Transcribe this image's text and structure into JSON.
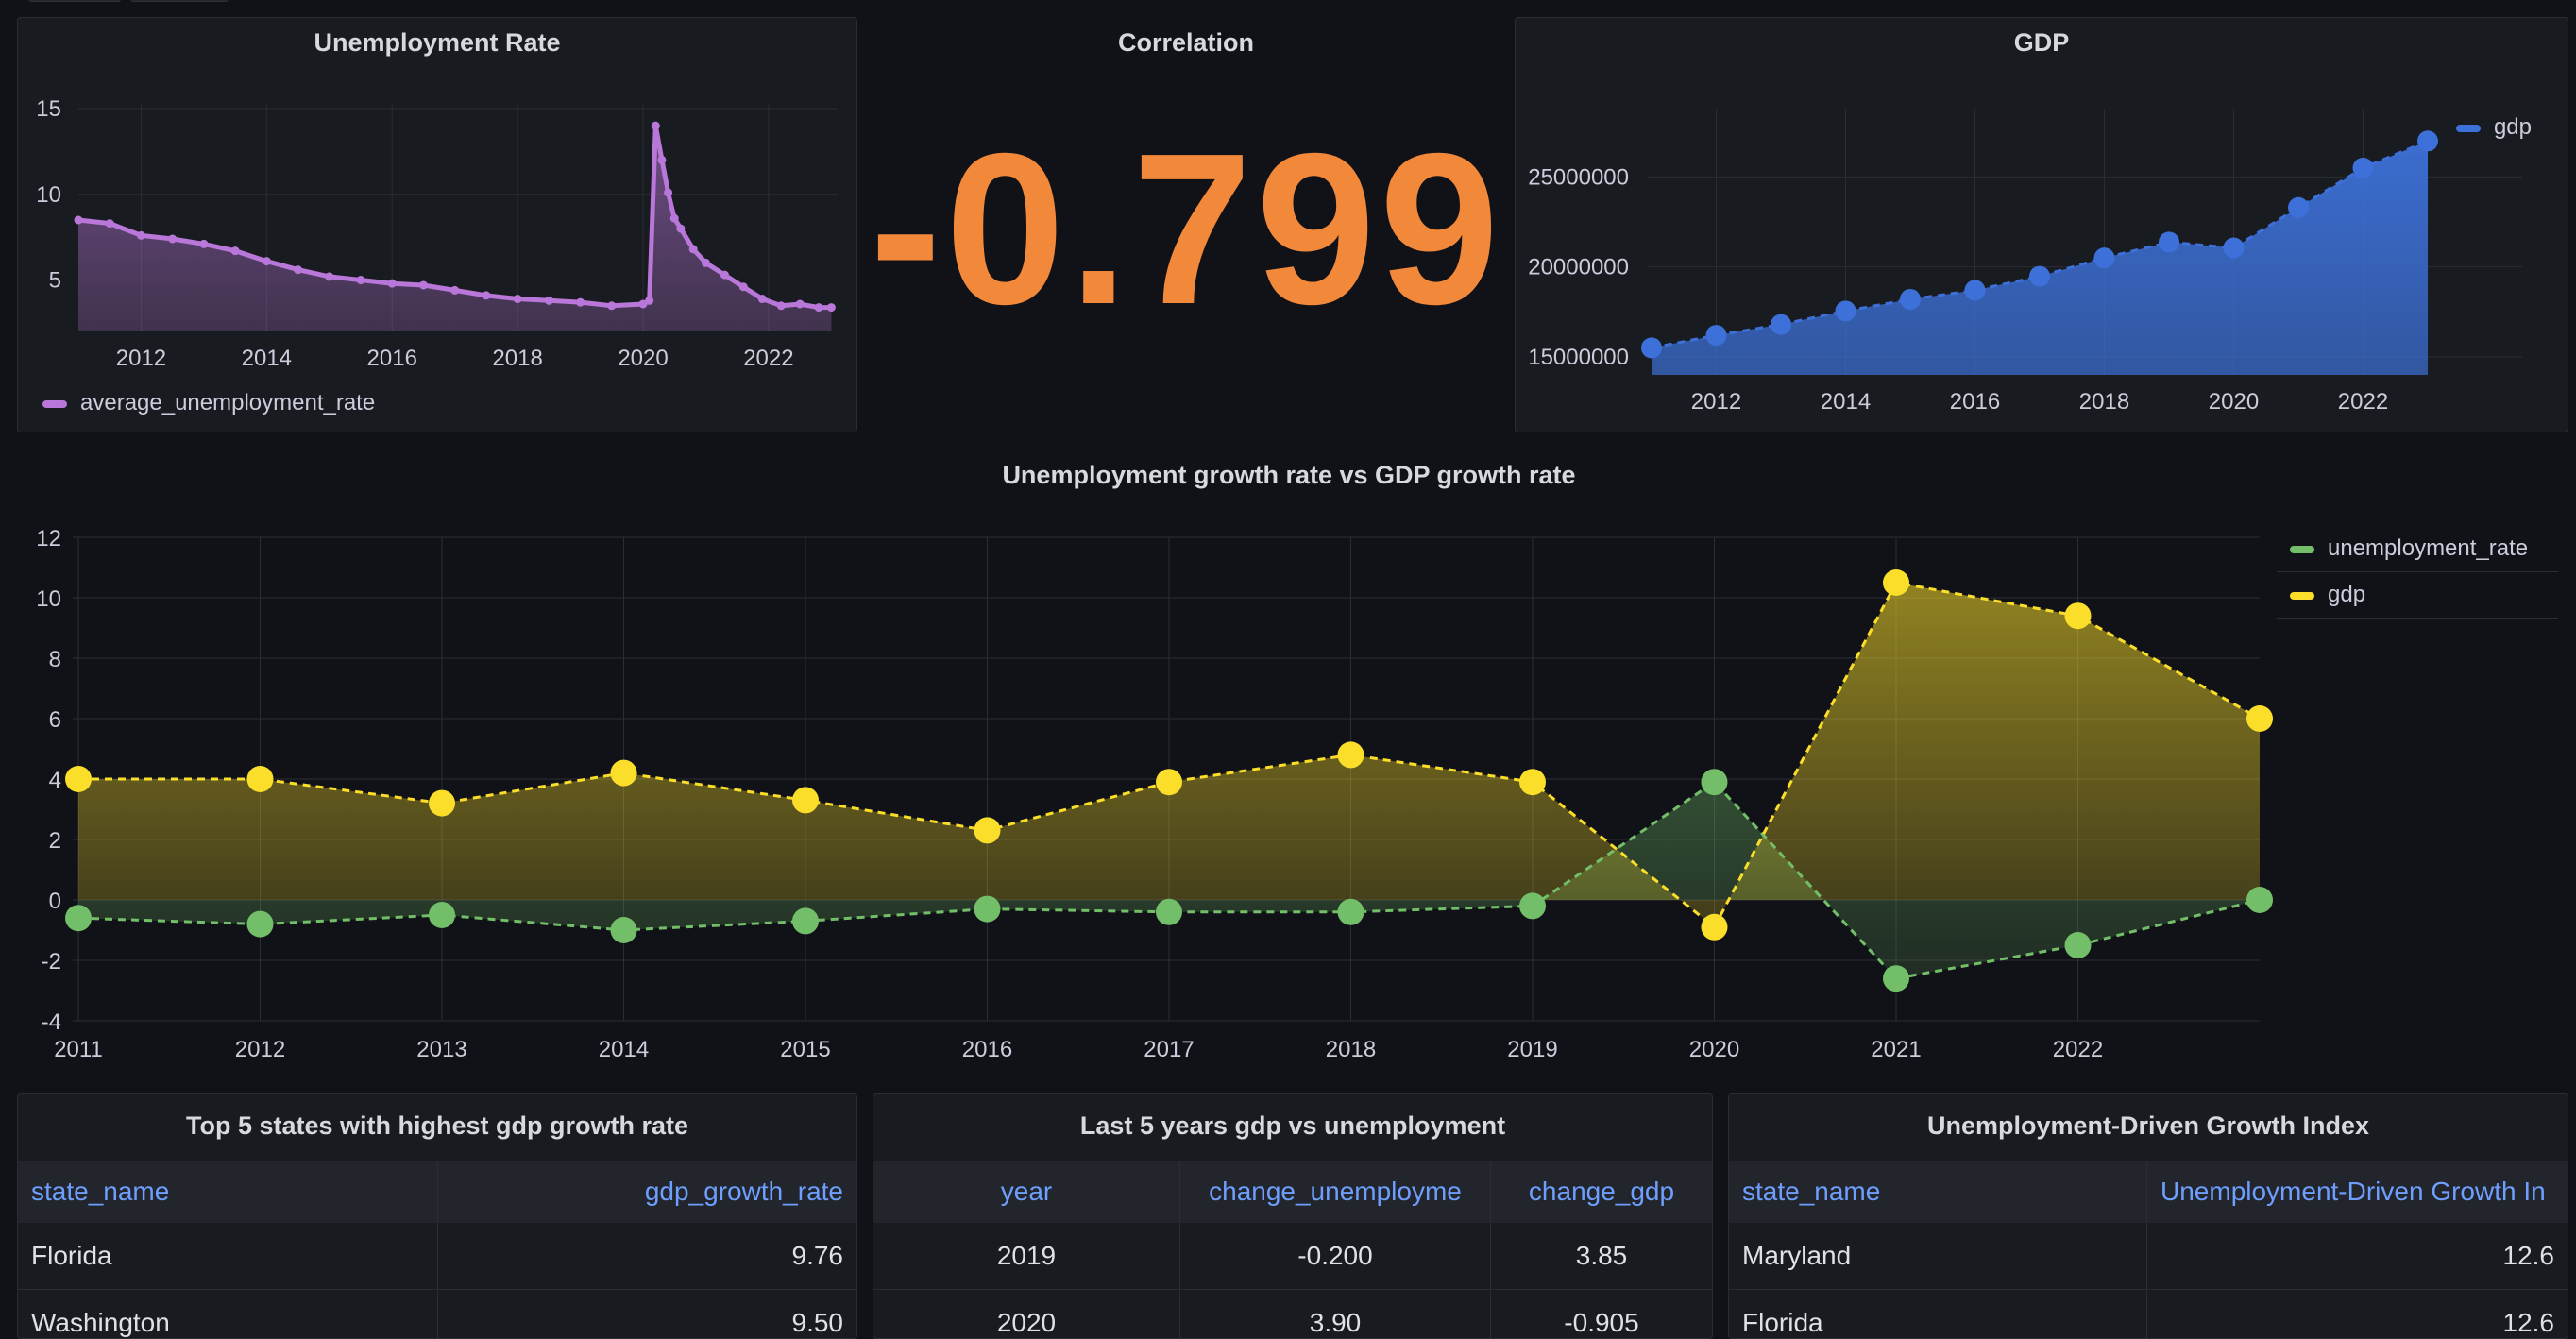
{
  "panels": {
    "unemployment_rate": {
      "title": "Unemployment Rate",
      "legend": "average_unemployment_rate",
      "color": "#b877d9"
    },
    "correlation": {
      "title": "Correlation",
      "value": "-0.799",
      "color": "#f2883a"
    },
    "gdp": {
      "title": "GDP",
      "legend": "gdp",
      "color": "#3d71d9"
    },
    "growth_vs": {
      "title": "Unemployment growth rate vs GDP growth rate",
      "legend_unemployment": "unemployment_rate",
      "legend_gdp": "gdp",
      "color_unemployment": "#73bf69",
      "color_gdp": "#fade2a"
    },
    "top5": {
      "title": "Top 5 states with highest gdp growth rate",
      "columns": [
        "state_name",
        "gdp_growth_rate"
      ],
      "rows": [
        [
          "Florida",
          "9.76"
        ],
        [
          "Washington",
          "9.50"
        ]
      ]
    },
    "last5": {
      "title": "Last 5 years gdp vs unemployment",
      "columns": [
        "year",
        "change_unemployme",
        "change_gdp"
      ],
      "rows": [
        [
          "2019",
          "-0.200",
          "3.85"
        ],
        [
          "2020",
          "3.90",
          "-0.905"
        ]
      ]
    },
    "udgi": {
      "title": "Unemployment-Driven Growth Index",
      "columns": [
        "state_name",
        "Unemployment-Driven Growth In"
      ],
      "rows": [
        [
          "Maryland",
          "12.6"
        ],
        [
          "Florida",
          "12.6"
        ]
      ]
    }
  },
  "chart_data": [
    {
      "type": "area",
      "title": "Unemployment Rate",
      "series": [
        {
          "name": "average_unemployment_rate"
        }
      ],
      "x": [
        2011.0,
        2011.5,
        2012.0,
        2012.5,
        2013.0,
        2013.5,
        2014.0,
        2014.5,
        2015.0,
        2015.5,
        2016.0,
        2016.5,
        2017.0,
        2017.5,
        2018.0,
        2018.5,
        2019.0,
        2019.5,
        2020.0,
        2020.1,
        2020.2,
        2020.3,
        2020.4,
        2020.5,
        2020.6,
        2020.8,
        2021.0,
        2021.3,
        2021.6,
        2021.9,
        2022.2,
        2022.5,
        2022.8,
        2023.0
      ],
      "y": [
        8.5,
        8.3,
        7.6,
        7.4,
        7.1,
        6.7,
        6.1,
        5.6,
        5.2,
        5.0,
        4.8,
        4.7,
        4.4,
        4.1,
        3.9,
        3.8,
        3.7,
        3.5,
        3.6,
        3.8,
        14.0,
        12.0,
        10.1,
        8.6,
        8.0,
        6.8,
        6.0,
        5.3,
        4.6,
        3.9,
        3.5,
        3.6,
        3.4,
        3.4
      ],
      "xticks": [
        "2012",
        "2014",
        "2016",
        "2018",
        "2020",
        "2022"
      ],
      "yticks": [
        "5",
        "10",
        "15"
      ],
      "xlim": [
        2011,
        2023.1
      ],
      "ylim": [
        2,
        15
      ]
    },
    {
      "type": "area",
      "title": "GDP",
      "series": [
        {
          "name": "gdp"
        }
      ],
      "x": [
        2011,
        2012,
        2013,
        2014,
        2015,
        2016,
        2017,
        2018,
        2019,
        2020,
        2021,
        2022,
        2023
      ],
      "y": [
        15500000,
        16200000,
        16800000,
        17550000,
        18200000,
        18700000,
        19480000,
        20500000,
        21380000,
        21060000,
        23300000,
        25500000,
        27000000
      ],
      "xticks": [
        "2012",
        "2014",
        "2016",
        "2018",
        "2020",
        "2022"
      ],
      "yticks": [
        "15000000",
        "20000000",
        "25000000"
      ],
      "xlim": [
        2011,
        2023
      ],
      "ylim": [
        14000000,
        28800000
      ]
    },
    {
      "type": "area",
      "title": "Unemployment growth rate vs GDP growth rate",
      "x": [
        2011,
        2012,
        2013,
        2014,
        2015,
        2016,
        2017,
        2018,
        2019,
        2020,
        2021,
        2022,
        2023
      ],
      "series": [
        {
          "name": "unemployment_rate",
          "values": [
            -0.6,
            -0.8,
            -0.5,
            -1.0,
            -0.7,
            -0.3,
            -0.4,
            -0.4,
            -0.2,
            3.9,
            -2.6,
            -1.5,
            0.0
          ]
        },
        {
          "name": "gdp",
          "values": [
            4.0,
            4.0,
            3.2,
            4.2,
            3.3,
            2.3,
            3.9,
            4.8,
            3.9,
            -0.9,
            10.5,
            9.4,
            6.0
          ]
        }
      ],
      "xticks": [
        "2011",
        "2012",
        "2013",
        "2014",
        "2015",
        "2016",
        "2017",
        "2018",
        "2019",
        "2020",
        "2021",
        "2022"
      ],
      "yticks": [
        "-4",
        "-2",
        "0",
        "2",
        "4",
        "6",
        "8",
        "10",
        "12"
      ],
      "ylim": [
        -4,
        12
      ]
    }
  ]
}
